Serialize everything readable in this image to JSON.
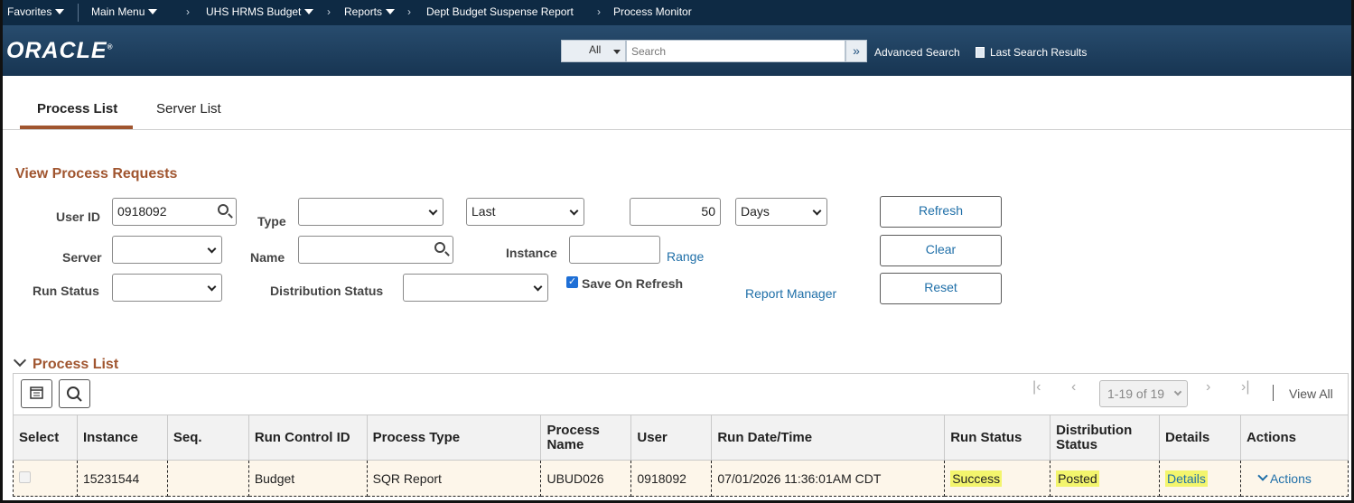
{
  "topnav": {
    "favorites": "Favorites",
    "main_menu": "Main Menu",
    "breadcrumbs": [
      "UHS HRMS Budget",
      "Reports",
      "Dept Budget Suspense Report",
      "Process Monitor"
    ]
  },
  "header": {
    "logo": "ORACLE",
    "search_scope": "All",
    "search_placeholder": "Search",
    "advanced_search": "Advanced Search",
    "last_search_results": "Last Search Results"
  },
  "tabs": [
    {
      "label": "Process List",
      "active": true
    },
    {
      "label": "Server List",
      "active": false
    }
  ],
  "filters": {
    "title": "View Process Requests",
    "user_id_label": "User ID",
    "user_id_value": "0918092",
    "type_label": "Type",
    "type_value": "",
    "last_value": "Last",
    "days_count": "50",
    "days_unit": "Days",
    "server_label": "Server",
    "server_value": "",
    "name_label": "Name",
    "name_value": "",
    "instance_label": "Instance",
    "instance_value": "",
    "range_link": "Range",
    "run_status_label": "Run Status",
    "run_status_value": "",
    "distribution_status_label": "Distribution Status",
    "distribution_status_value": "",
    "save_on_refresh_label": "Save On Refresh",
    "save_on_refresh_checked": true,
    "report_manager_link": "Report Manager",
    "refresh_button": "Refresh",
    "clear_button": "Clear",
    "reset_button": "Reset"
  },
  "process_list": {
    "title": "Process List",
    "pagination": "1-19 of 19",
    "view_all": "View All",
    "columns": [
      "Select",
      "Instance",
      "Seq.",
      "Run Control ID",
      "Process Type",
      "Process Name",
      "User",
      "Run Date/Time",
      "Run Status",
      "Distribution Status",
      "Details",
      "Actions"
    ],
    "rows": [
      {
        "instance": "15231544",
        "seq": "",
        "run_control_id": "Budget",
        "process_type": "SQR Report",
        "process_name": "UBUD026",
        "user": "0918092",
        "run_datetime": "07/01/2026 11:36:01AM CDT",
        "run_status": "Success",
        "distribution_status": "Posted",
        "details": "Details",
        "actions": "Actions"
      }
    ]
  },
  "colors": {
    "nav_bg": "#0e2a44",
    "header_bg": "#284c6e",
    "accent": "#a0552f",
    "link": "#1f6fa8",
    "highlight": "#f3f56d",
    "row_bg": "#fdf6ea"
  }
}
